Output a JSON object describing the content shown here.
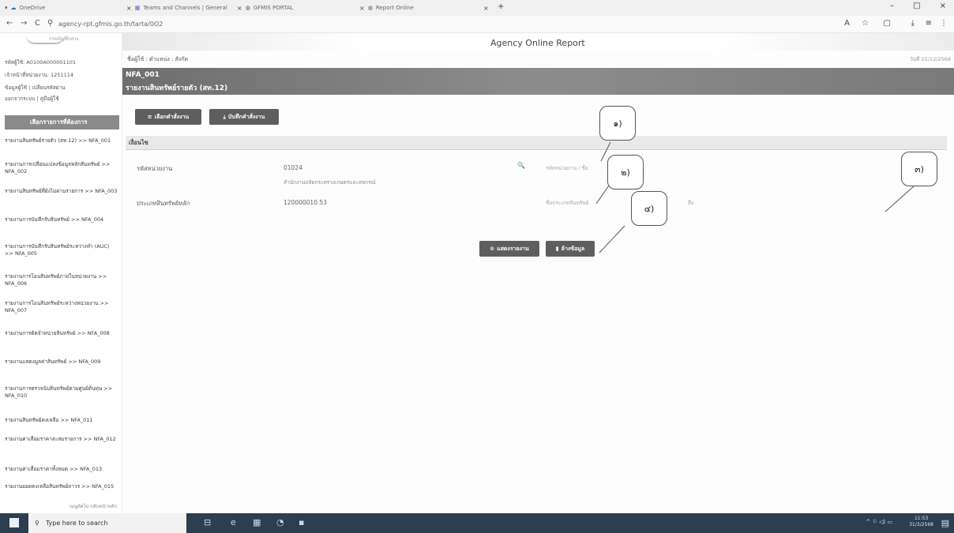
{
  "browser": {
    "tabs": [
      {
        "label": "OneDrive",
        "close": ""
      },
      {
        "label": "Teams and Channels | General",
        "close": "×"
      },
      {
        "label": "GFMIS PORTAL",
        "close": "×"
      },
      {
        "label": "Report Online",
        "close": "×"
      }
    ],
    "first_close": "×",
    "new_tab": "+",
    "window_controls": {
      "min": "–",
      "max": "□",
      "close": "×"
    },
    "url": "agency-rpt.gfmis.go.th/tarta/0O2",
    "nav": {
      "back": "←",
      "forward": "→",
      "reload": "C",
      "site_info": "⚲"
    },
    "toolbar_icons": {
      "translate": "A",
      "star": "☆",
      "extensions": "▢",
      "download": "⤓",
      "profile": "≡",
      "menu": "⋮"
    }
  },
  "sidebar": {
    "logo_text": "กรมบัญชีกลาง",
    "user_lines": [
      "รหัสผู้ใช้: A0100A000001101",
      "เจ้าหน้าที่หน่วยงาน: 1251114",
      "ข้อมูลผู้ใช้ | เปลี่ยนรหัสผ่าน",
      "ออกจากระบบ | คู่มือผู้ใช้"
    ],
    "menu_header": "เลือกรายการที่ต้องการ",
    "items": [
      "รายงานสินทรัพย์รายตัว (สท.12) >> NFA_001",
      "รายงานการเปลี่ยนแปลงข้อมูลหลักสินทรัพย์ >> NFA_002",
      "รายงานสินทรัพย์ที่ยังไม่ผ่านรายการ >> NFA_003",
      "รายงานการบันทึกรับสินทรัพย์ >> NFA_004",
      "รายงานการบันทึกรับสินทรัพย์ระหว่างทำ (AUC) >> NFA_005",
      "รายงานการโอนสินทรัพย์ภายในหน่วยงาน >> NFA_006",
      "รายงานการโอนสินทรัพย์ระหว่างหน่วยงาน >> NFA_007",
      "รายงานการตัดจำหน่ายสินทรัพย์ >> NFA_008",
      "รายงานแสดงมูลค่าสินทรัพย์ >> NFA_009",
      "รายงานการตรวจนับสินทรัพย์ตามศูนย์ต้นทุน >> NFA_010",
      "รายงานสินทรัพย์คงเหลือ >> NFA_011",
      "รายงานค่าเสื่อมราคาสะสมรายการ >> NFA_012",
      "รายงานค่าเสื่อมราคาทั้งหมด >> NFA_013",
      "รายงานยอดคงเหลือสินทรัพย์ถาวร >> NFA_015"
    ],
    "footer": "เมนูถัดไป กลับหน้าหลัก"
  },
  "main": {
    "app_title": "Agency Online Report",
    "breadcrumb": "ชื่อผู้ใช้ : ตำแหน่ง : สังกัด",
    "datestamp": "วันที่ 25/12/2568",
    "banner": {
      "code": "NFA_001",
      "title": "รายงานสินทรัพย์รายตัว (สท.12)"
    },
    "top_buttons": [
      {
        "icon": "≡",
        "label": "เลือกคำสั่งงาน"
      },
      {
        "icon": "⤓",
        "label": "บันทึกคำสั่งงาน"
      }
    ],
    "section_title": "เงื่อนไข",
    "fields": {
      "unit_label": "รหัสหน่วยงาน",
      "unit_value": "01024",
      "unit_desc": "สำนักงานปลัดกระทรวงเกษตรและสหกรณ์",
      "search_icon": "🔍",
      "unit_hint": "รหัสหน่วยงาน / ชื่อ",
      "asset_label": "ประเภทสินทรัพย์หลัก",
      "asset_value": "120000010.53",
      "asset_hint": "ชื่อประเภทสินทรัพย์",
      "asset_extra": "ถึง"
    },
    "actions": [
      {
        "icon": "⊙",
        "label": "แสดงรายงาน"
      },
      {
        "icon": "▮",
        "label": "ล้างข้อมูล"
      }
    ],
    "callouts": [
      "๑)",
      "๒)",
      "๓)",
      "๔)"
    ]
  },
  "taskbar": {
    "search_placeholder": "Type here to search",
    "search_icon": "⚲",
    "apps": [
      "⊟",
      "e",
      "▦",
      "◔",
      "▪"
    ],
    "tray": "^ ⚐ ◁) ▭",
    "clock_time": "11:53",
    "clock_date": "31/3/2568",
    "notif": "▤"
  }
}
